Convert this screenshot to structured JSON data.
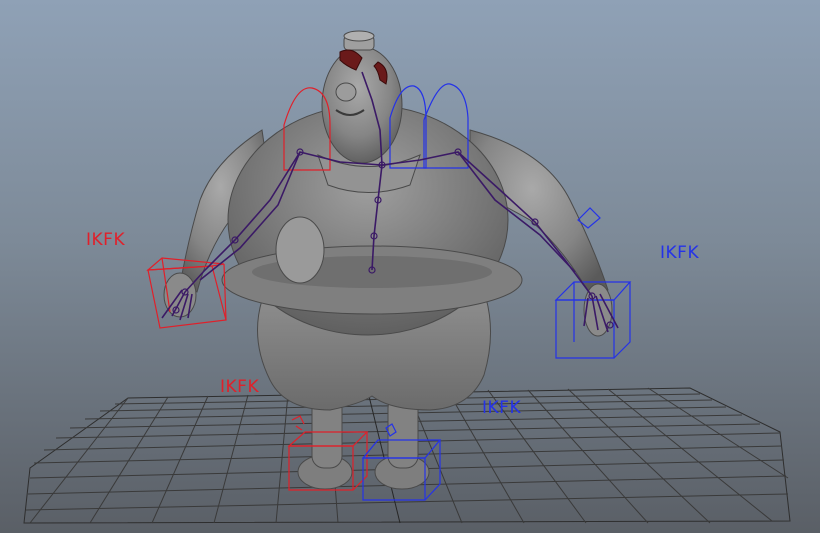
{
  "viewport": {
    "name": "3D perspective viewport",
    "character": "rigged-character",
    "colors": {
      "left_controls": "#e0202a",
      "right_controls": "#2432e8",
      "skeleton": "#3b1a66",
      "grid": "#3a3a3a",
      "mesh": "#8a8a8a"
    }
  },
  "labels": {
    "arm_left_switch": "IKFK",
    "arm_right_switch": "IKFK",
    "leg_left_switch": "IKFK",
    "leg_right_switch": "IKFK"
  }
}
